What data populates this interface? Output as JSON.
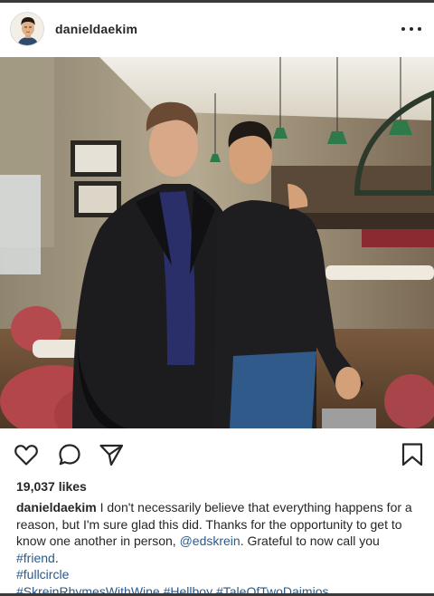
{
  "post": {
    "username": "danieldaekim",
    "likes": "19,037 likes",
    "caption": {
      "user": "danieldaekim",
      "text_1": " I don't necessarily believe that everything happens for a reason, but I'm sure glad this did. Thanks for the opportunity to get to know one another in person, ",
      "mention": "@edskrein",
      "text_2": ". Grateful to now call you ",
      "tag_friend": "#friend",
      "text_3": ".",
      "tag_fullcircle": "#fullcircle",
      "tag_skrein": "#SkreinRhymesWithWine",
      "tag_hellboy": "#Hellboy",
      "tag_tale": "#TaleOfTwoDaimios"
    }
  },
  "icons": {
    "more": "more-options-icon",
    "like": "heart-icon",
    "comment": "comment-icon",
    "share": "paper-plane-icon",
    "save": "bookmark-icon"
  },
  "colors": {
    "text": "#262626",
    "link": "#2a5a8a",
    "border": "#dbdbdb"
  }
}
